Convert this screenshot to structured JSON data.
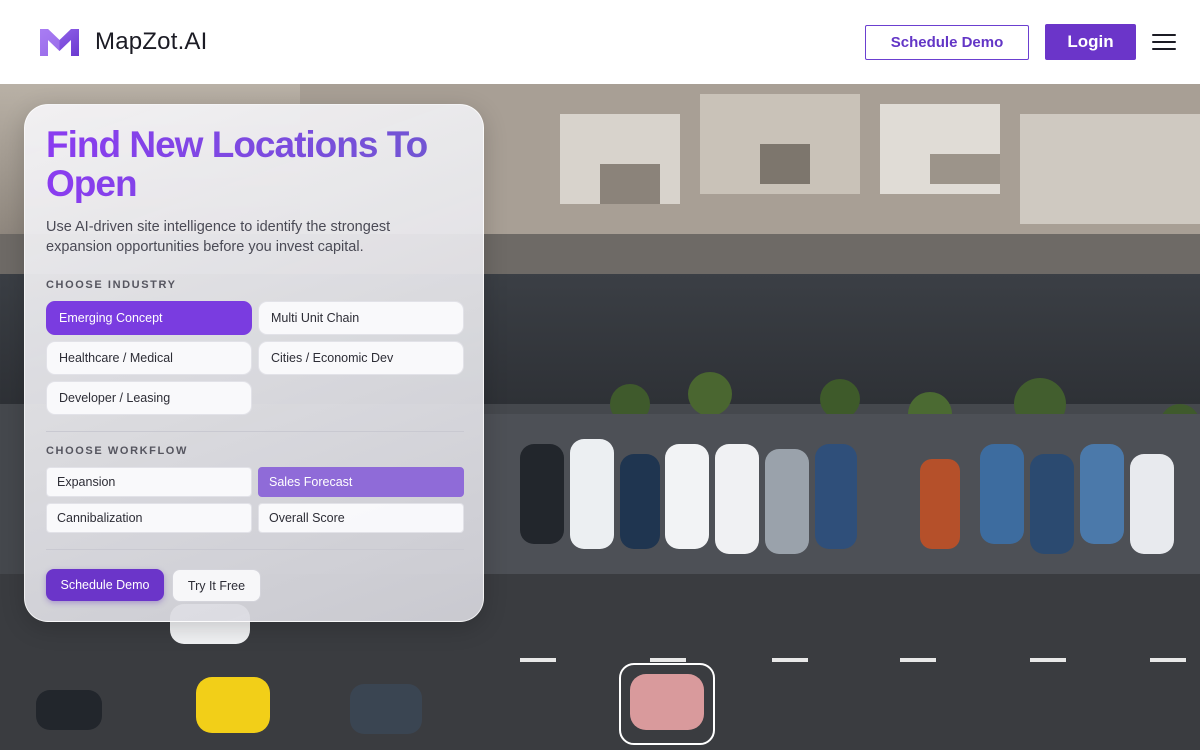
{
  "brand": {
    "name": "MapZot.AI",
    "logo_icon": "m-logo-icon",
    "accent": "#6b35c9"
  },
  "header": {
    "schedule_demo_label": "Schedule Demo",
    "login_label": "Login",
    "menu_icon": "hamburger-menu-icon"
  },
  "hero": {
    "title": "Find New Locations To Open",
    "subtitle": "Use AI-driven site intelligence to identify the strongest expansion opportunities before you invest capital."
  },
  "industry": {
    "label": "CHOOSE INDUSTRY",
    "options": [
      {
        "label": "Emerging Concept",
        "selected": true
      },
      {
        "label": "Multi Unit Chain",
        "selected": false
      },
      {
        "label": "Healthcare / Medical",
        "selected": false
      },
      {
        "label": "Cities / Economic Dev",
        "selected": false
      },
      {
        "label": "Developer / Leasing",
        "selected": false
      }
    ]
  },
  "workflow": {
    "label": "CHOOSE WORKFLOW",
    "options": [
      {
        "label": "Expansion",
        "selected": false
      },
      {
        "label": "Sales Forecast",
        "selected": true
      },
      {
        "label": "Cannibalization",
        "selected": false
      },
      {
        "label": "Overall Score",
        "selected": false
      }
    ]
  },
  "actions": {
    "primary_label": "Schedule Demo",
    "secondary_label": "Try It Free"
  },
  "colors": {
    "selected_industry": "#7a3ce0",
    "selected_workflow": "#8f6bd8",
    "title_gradient_start": "#8a3cf0",
    "title_gradient_end": "#6f57d0"
  }
}
